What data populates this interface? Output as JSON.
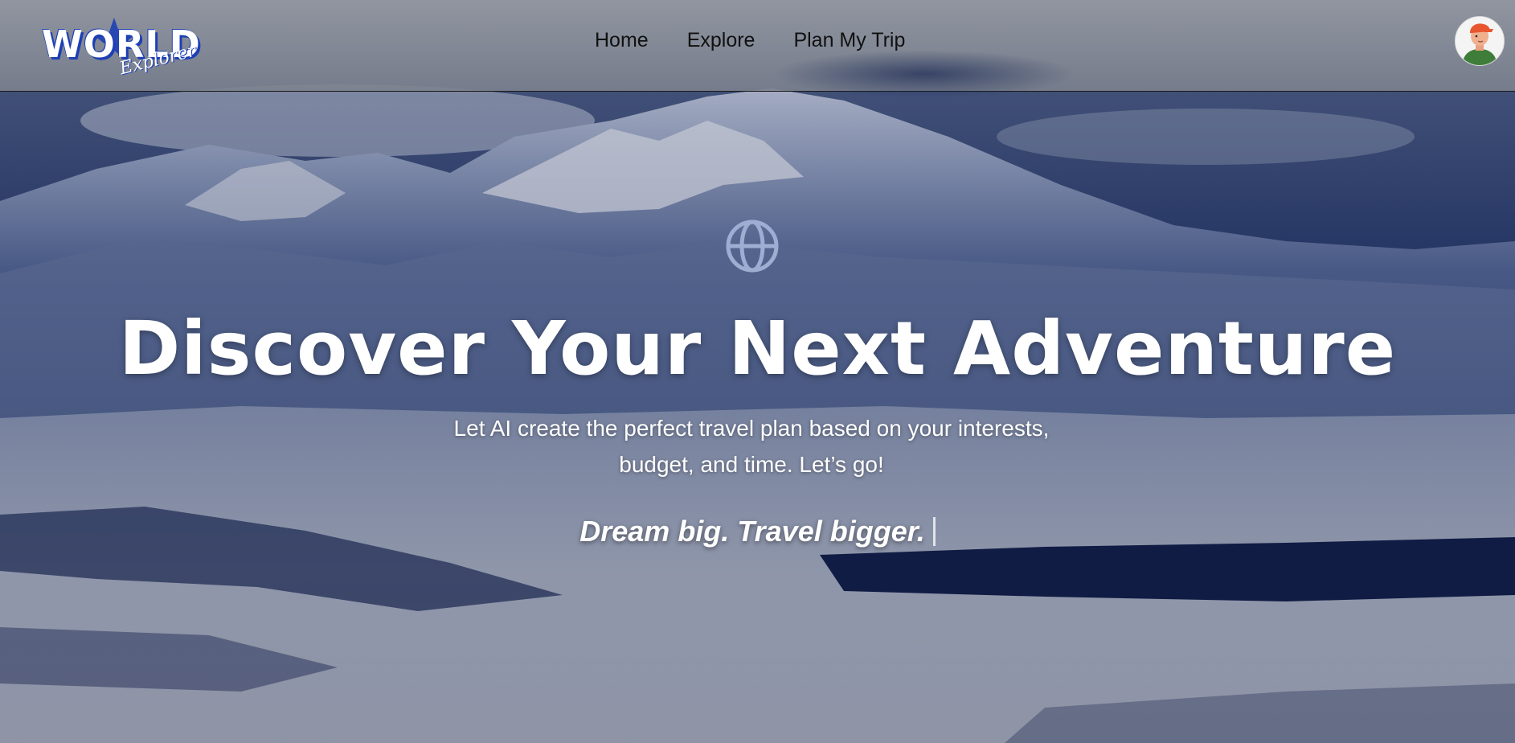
{
  "brand": {
    "logo_word": "WORLD",
    "logo_sub": "Explorer",
    "accent_color": "#1d3fb5"
  },
  "nav": {
    "links": [
      "Home",
      "Explore",
      "Plan My Trip"
    ]
  },
  "user": {
    "avatar_icon": "user-avatar-icon"
  },
  "hero": {
    "icon": "globe-icon",
    "title": "Discover Your Next Adventure",
    "subtitle": "Let AI create the perfect travel plan based on your interests, budget, and time. Let’s go!",
    "tagline": "Dream big. Travel bigger."
  },
  "colors": {
    "text": "#ffffff",
    "nav_text": "#111111",
    "overlay": "#0f1c3a"
  }
}
